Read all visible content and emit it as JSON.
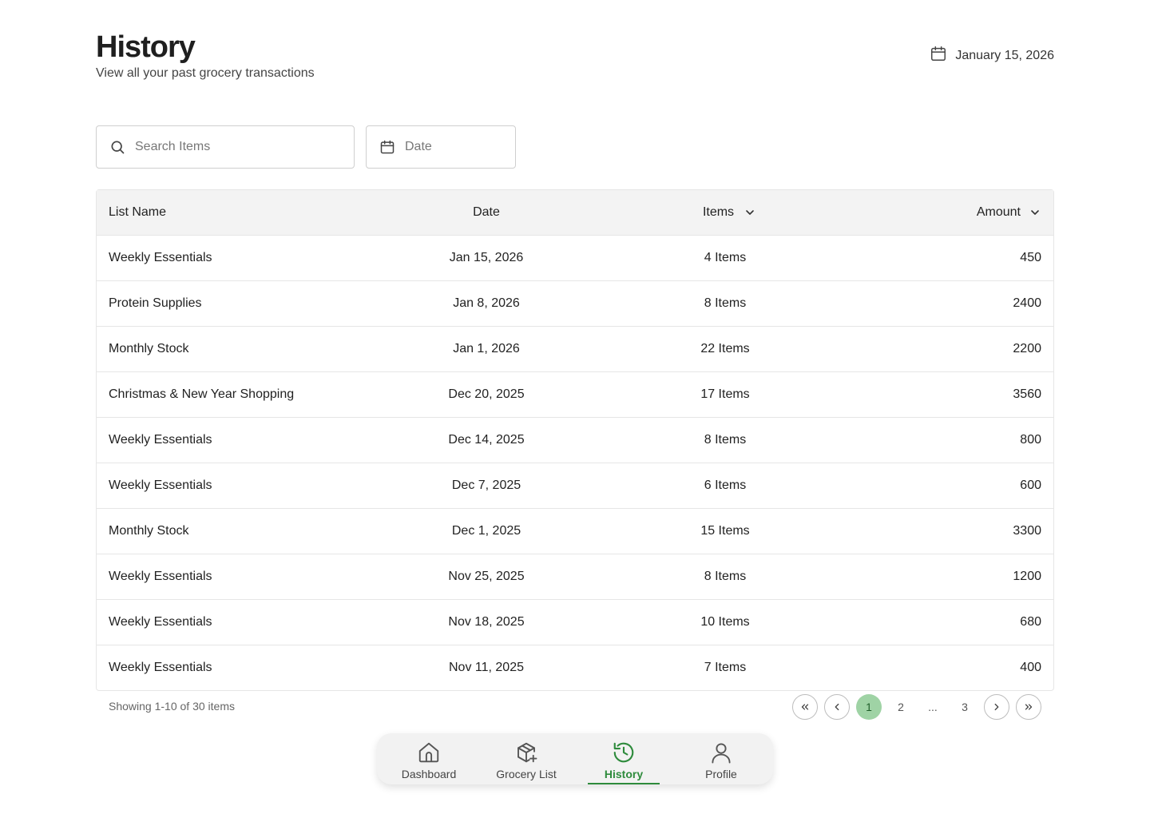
{
  "header": {
    "title": "History",
    "subtitle": "View all your past grocery transactions",
    "current_date": "January 15, 2026"
  },
  "filters": {
    "search_placeholder": "Search Items",
    "date_placeholder": "Date"
  },
  "table": {
    "columns": {
      "list_name": "List Name",
      "date": "Date",
      "items": "Items",
      "amount": "Amount"
    },
    "rows": [
      {
        "name": "Weekly Essentials",
        "date": "Jan 15, 2026",
        "items": "4 Items",
        "amount": "450"
      },
      {
        "name": "Protein Supplies",
        "date": "Jan 8, 2026",
        "items": "8 Items",
        "amount": "2400"
      },
      {
        "name": "Monthly Stock",
        "date": "Jan 1, 2026",
        "items": "22 Items",
        "amount": "2200"
      },
      {
        "name": "Christmas & New Year Shopping",
        "date": "Dec 20, 2025",
        "items": "17 Items",
        "amount": "3560"
      },
      {
        "name": "Weekly Essentials",
        "date": "Dec 14, 2025",
        "items": "8 Items",
        "amount": "800"
      },
      {
        "name": "Weekly Essentials",
        "date": "Dec 7, 2025",
        "items": "6 Items",
        "amount": "600"
      },
      {
        "name": "Monthly Stock",
        "date": "Dec 1, 2025",
        "items": "15 Items",
        "amount": "3300"
      },
      {
        "name": "Weekly Essentials",
        "date": "Nov 25, 2025",
        "items": "8 Items",
        "amount": "1200"
      },
      {
        "name": "Weekly Essentials",
        "date": "Nov 18, 2025",
        "items": "10 Items",
        "amount": "680"
      },
      {
        "name": "Weekly Essentials",
        "date": "Nov 11, 2025",
        "items": "7 Items",
        "amount": "400"
      }
    ]
  },
  "pagination": {
    "showing": "Showing 1-10 of 30 items",
    "pages": [
      "1",
      "2",
      "...",
      "3"
    ],
    "active_page": "1"
  },
  "nav": {
    "items": [
      {
        "label": "Dashboard",
        "icon": "home-icon"
      },
      {
        "label": "Grocery List",
        "icon": "package-add-icon"
      },
      {
        "label": "History",
        "icon": "history-icon",
        "active": true
      },
      {
        "label": "Profile",
        "icon": "user-icon"
      }
    ]
  },
  "colors": {
    "accent": "#2e8b3c",
    "active_page_bg": "#9fd3a5",
    "table_header_bg": "#f3f3f3"
  }
}
